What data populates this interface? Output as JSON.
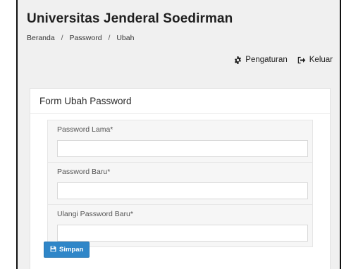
{
  "header": {
    "title": "Universitas Jenderal Soedirman"
  },
  "breadcrumb": {
    "items": [
      "Beranda",
      "Password",
      "Ubah"
    ],
    "separator": "/"
  },
  "topnav": {
    "settings_label": "Pengaturan",
    "settings_icon": "gear-icon",
    "logout_label": "Keluar",
    "logout_icon": "logout-icon"
  },
  "form": {
    "title": "Form Ubah Password",
    "fields": [
      {
        "label": "Password Lama*",
        "value": "",
        "placeholder": ""
      },
      {
        "label": "Password Baru*",
        "value": "",
        "placeholder": ""
      },
      {
        "label": "Ulangi Password Baru*",
        "value": "",
        "placeholder": ""
      }
    ],
    "submit_label": "Simpan",
    "submit_icon": "save-icon"
  },
  "colors": {
    "primary_button": "#2f86c8",
    "page_background": "#f0f0f0",
    "panel_background": "#ffffff"
  }
}
